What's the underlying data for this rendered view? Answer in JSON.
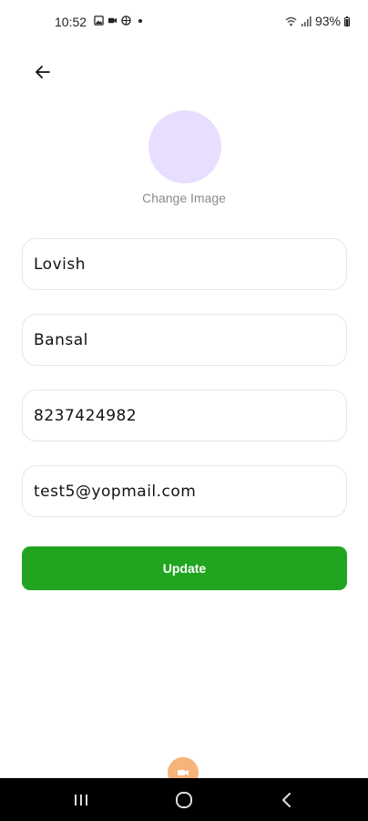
{
  "status_bar": {
    "time": "10:52",
    "battery": "93%",
    "icons": [
      "gallery-icon",
      "video-icon",
      "globe-icon",
      "wifi-icon",
      "signal-icon",
      "battery-icon"
    ]
  },
  "header": {
    "back_icon": "arrow-left-icon"
  },
  "profile": {
    "avatar_color": "#e8deff",
    "change_image_label": "Change Image"
  },
  "form": {
    "first_name": "Lovish",
    "last_name": "Bansal",
    "phone": "8237424982",
    "email": "test5@yopmail.com"
  },
  "actions": {
    "update_label": "Update",
    "update_color": "#21a521"
  },
  "floating": {
    "icon": "video-icon",
    "color": "#f6b37a"
  },
  "nav": {
    "items": [
      "recent-apps-icon",
      "home-icon",
      "back-icon"
    ]
  }
}
